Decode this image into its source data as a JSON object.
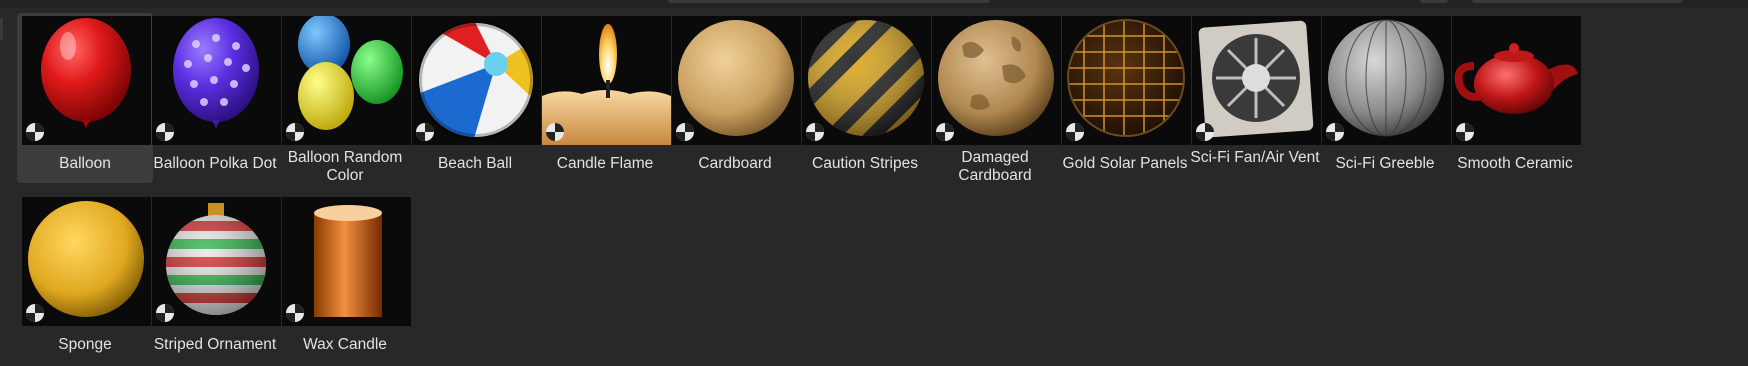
{
  "assets": [
    {
      "label": "Balloon",
      "icon": "balloon-red-thumbnail",
      "selected": true
    },
    {
      "label": "Balloon Polka Dot",
      "icon": "balloon-polka-dot-thumbnail"
    },
    {
      "label": "Balloon Random Color",
      "icon": "balloon-random-color-thumbnail"
    },
    {
      "label": "Beach Ball",
      "icon": "beach-ball-thumbnail"
    },
    {
      "label": "Candle Flame",
      "icon": "candle-flame-thumbnail"
    },
    {
      "label": "Cardboard",
      "icon": "cardboard-sphere-thumbnail"
    },
    {
      "label": "Caution Stripes",
      "icon": "caution-stripes-sphere-thumbnail"
    },
    {
      "label": "Damaged Cardboard",
      "icon": "damaged-cardboard-sphere-thumbnail"
    },
    {
      "label": "Gold Solar Panels",
      "icon": "gold-solar-panels-sphere-thumbnail"
    },
    {
      "label": "Sci-Fi Fan/Air Vent",
      "icon": "scifi-fan-vent-thumbnail"
    },
    {
      "label": "Sci-Fi Greeble",
      "icon": "scifi-greeble-sphere-thumbnail"
    },
    {
      "label": "Smooth Ceramic",
      "icon": "ceramic-teapot-thumbnail"
    },
    {
      "label": "Sponge",
      "icon": "sponge-sphere-thumbnail"
    },
    {
      "label": "Striped Ornament",
      "icon": "striped-ornament-thumbnail"
    },
    {
      "label": "Wax Candle",
      "icon": "wax-candle-thumbnail"
    }
  ],
  "badge_icon": "material-type-icon",
  "colors": {
    "background": "#282828",
    "selected": "#3d3d3d",
    "thumb": "#0a0a0a",
    "text": "#e2e2e2"
  }
}
